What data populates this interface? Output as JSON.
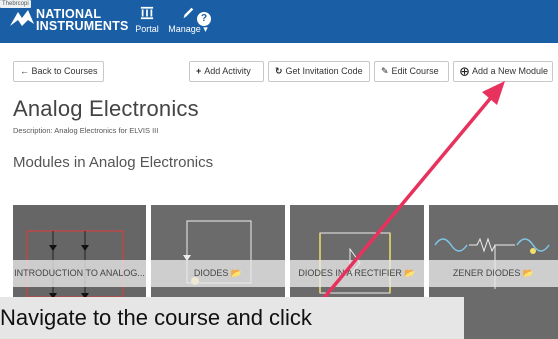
{
  "nav": {
    "brand_line1": "NATIONAL",
    "brand_line2": "INSTRUMENTS",
    "thumb_label": "Thebrcopi",
    "portal_label": "Portal",
    "manage_label": "Manage ▾",
    "help_glyph": "?"
  },
  "toolbar": {
    "back_label": "← Back to Courses",
    "add_activity_label": "Add Activity",
    "invitation_label": "Get Invitation Code",
    "edit_course_label": "Edit Course",
    "add_module_label": "Add a New Module"
  },
  "course": {
    "title": "Analog Electronics",
    "description": "Description: Analog Electronics for ELVIS III",
    "modules_heading": "Modules in Analog Electronics"
  },
  "modules": [
    {
      "label": "INTRODUCTION TO ANALOG..."
    },
    {
      "label": "DIODES 📂"
    },
    {
      "label": "DIODES IN A RECTIFIER 📂"
    },
    {
      "label": "ZENER DIODES 📂"
    }
  ],
  "caption": {
    "text": "Navigate to the course and click"
  },
  "colors": {
    "navbar": "#1a5fa6",
    "arrow": "#e8325e",
    "card_bg": "#6f6f6f"
  },
  "icons": {
    "portal": "bank-icon",
    "manage": "pencil-icon",
    "help": "question-circle-icon",
    "add": "plus-icon",
    "refresh": "refresh-icon",
    "edit": "edit-icon",
    "add_circle": "plus-circle-icon",
    "folder": "folder-open-icon"
  }
}
